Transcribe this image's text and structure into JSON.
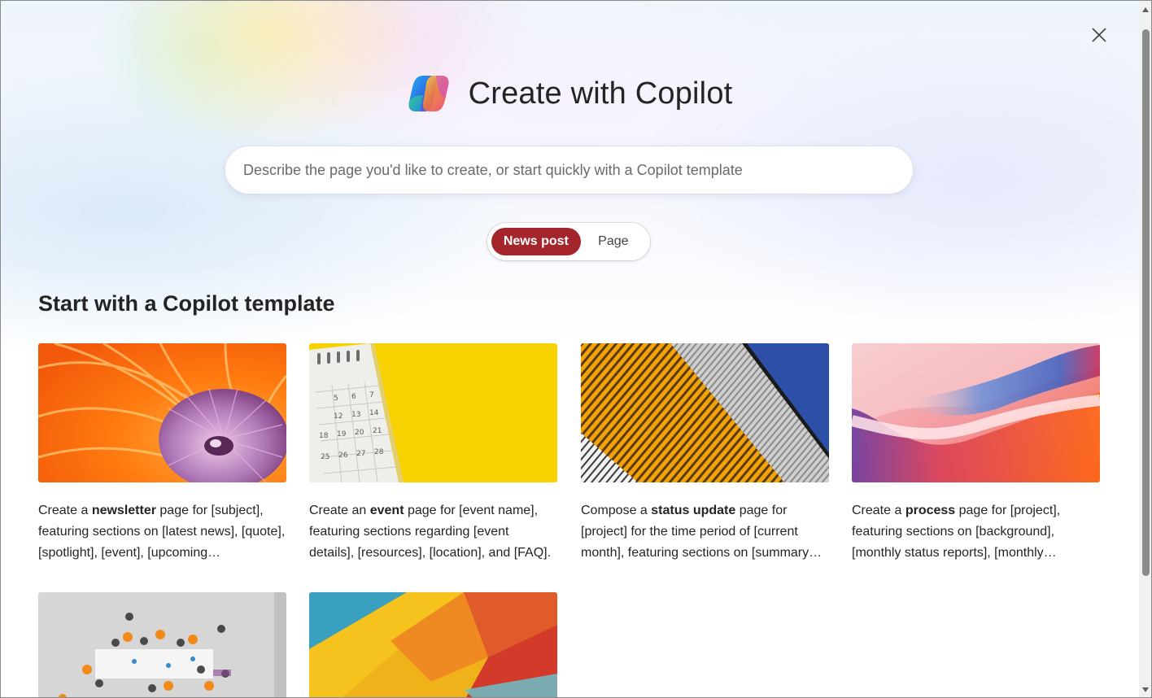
{
  "dialog": {
    "title": "Create with Copilot",
    "close_icon": "close-icon",
    "logo_icon": "copilot-logo-icon"
  },
  "search": {
    "placeholder": "Describe the page you'd like to create, or start quickly with a Copilot template",
    "value": ""
  },
  "toggle": {
    "options": [
      {
        "label": "News post",
        "selected": true
      },
      {
        "label": "Page",
        "selected": false
      }
    ],
    "accent": "#a4262c"
  },
  "templates": {
    "heading": "Start with a Copilot template",
    "cards": [
      {
        "image": "nautilus-shell-image",
        "prefix": "Create a ",
        "keyword": "newsletter",
        "suffix": " page for [subject], featuring sections on [latest news], [quote], [spotlight], [event], [upcoming…"
      },
      {
        "image": "calendar-on-yellow-image",
        "prefix": "Create an ",
        "keyword": "event",
        "suffix": " page for [event name], featuring sections regarding [event details], [resources], [location], and [FAQ]."
      },
      {
        "image": "building-facade-image",
        "prefix": "Compose a ",
        "keyword": "status update",
        "suffix": " page for [project] for the time period of [current month], featuring sections on [summary…"
      },
      {
        "image": "abstract-waves-image",
        "prefix": "Create a ",
        "keyword": "process",
        "suffix": " page for [project], featuring sections on [background], [monthly status reports], [monthly…"
      },
      {
        "image": "meeting-aerial-image",
        "prefix": "",
        "keyword": "",
        "suffix": ""
      },
      {
        "image": "colorful-geometric-image",
        "prefix": "",
        "keyword": "",
        "suffix": ""
      }
    ]
  },
  "scrollbar": {
    "up_icon": "scroll-up-arrow-icon",
    "down_icon": "scroll-down-arrow-icon"
  }
}
